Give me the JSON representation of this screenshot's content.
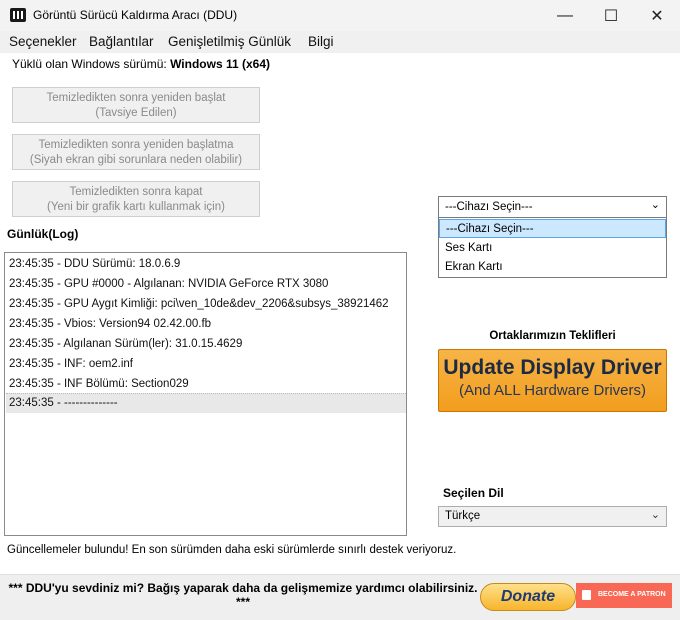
{
  "window": {
    "title": "Görüntü Sürücü Kaldırma Aracı (DDU)",
    "minimize_glyph": "—",
    "maximize_glyph": "☐",
    "close_glyph": "✕"
  },
  "menu": {
    "items": [
      "Seçenekler",
      "Bağlantılar",
      "Genişletilmiş Günlük",
      "Bilgi"
    ]
  },
  "windows_version": {
    "label": "Yüklü olan Windows sürümü: ",
    "value": "Windows 11 (x64)"
  },
  "actions": [
    {
      "line1": "Temizledikten sonra yeniden başlat",
      "line2": "(Tavsiye Edilen)"
    },
    {
      "line1": "Temizledikten sonra yeniden başlatma",
      "line2": "(Siyah ekran gibi sorunlara neden olabilir)"
    },
    {
      "line1": "Temizledikten sonra kapat",
      "line2": "(Yeni bir grafik kartı kullanmak için)"
    }
  ],
  "log": {
    "label": "Günlük(Log)",
    "lines": [
      "23:45:35 - DDU Sürümü: 18.0.6.9",
      "23:45:35 - GPU #0000 - Algılanan: NVIDIA GeForce RTX 3080",
      "23:45:35 - GPU Aygıt Kimliği: pci\\ven_10de&dev_2206&subsys_38921462",
      "23:45:35 - Vbios: Version94 02.42.00.fb",
      "23:45:35 - Algılanan Sürüm(ler): 31.0.15.4629",
      "23:45:35 - INF: oem2.inf",
      "23:45:35 - INF Bölümü: Section029",
      "23:45:35 - --------------"
    ]
  },
  "device_select": {
    "selected": "---Cihazı Seçin---",
    "options": [
      "---Cihazı Seçin---",
      "Ses Kartı",
      "Ekran Kartı"
    ]
  },
  "partners": {
    "label": "Ortaklarımızın Teklifleri",
    "ad_title": "Update Display Driver",
    "ad_subtitle": "(And ALL Hardware Drivers)"
  },
  "language": {
    "label": "Seçilen Dil",
    "selected": "Türkçe"
  },
  "status_text": "Güncellemeler bulundu! En son sürümden daha eski sürümlerde sınırlı destek veriyoruz.",
  "footer": {
    "text": "*** DDU'yu sevdiniz mi? Bağış yaparak daha da gelişmemize yardımcı olabilirsiniz. ***",
    "donate_label": "Donate",
    "patreon_label": "BECOME A PATRON"
  },
  "colors": {
    "accent_orange": "#f29d1d",
    "patreon": "#f96854",
    "selection": "#cce8ff"
  }
}
